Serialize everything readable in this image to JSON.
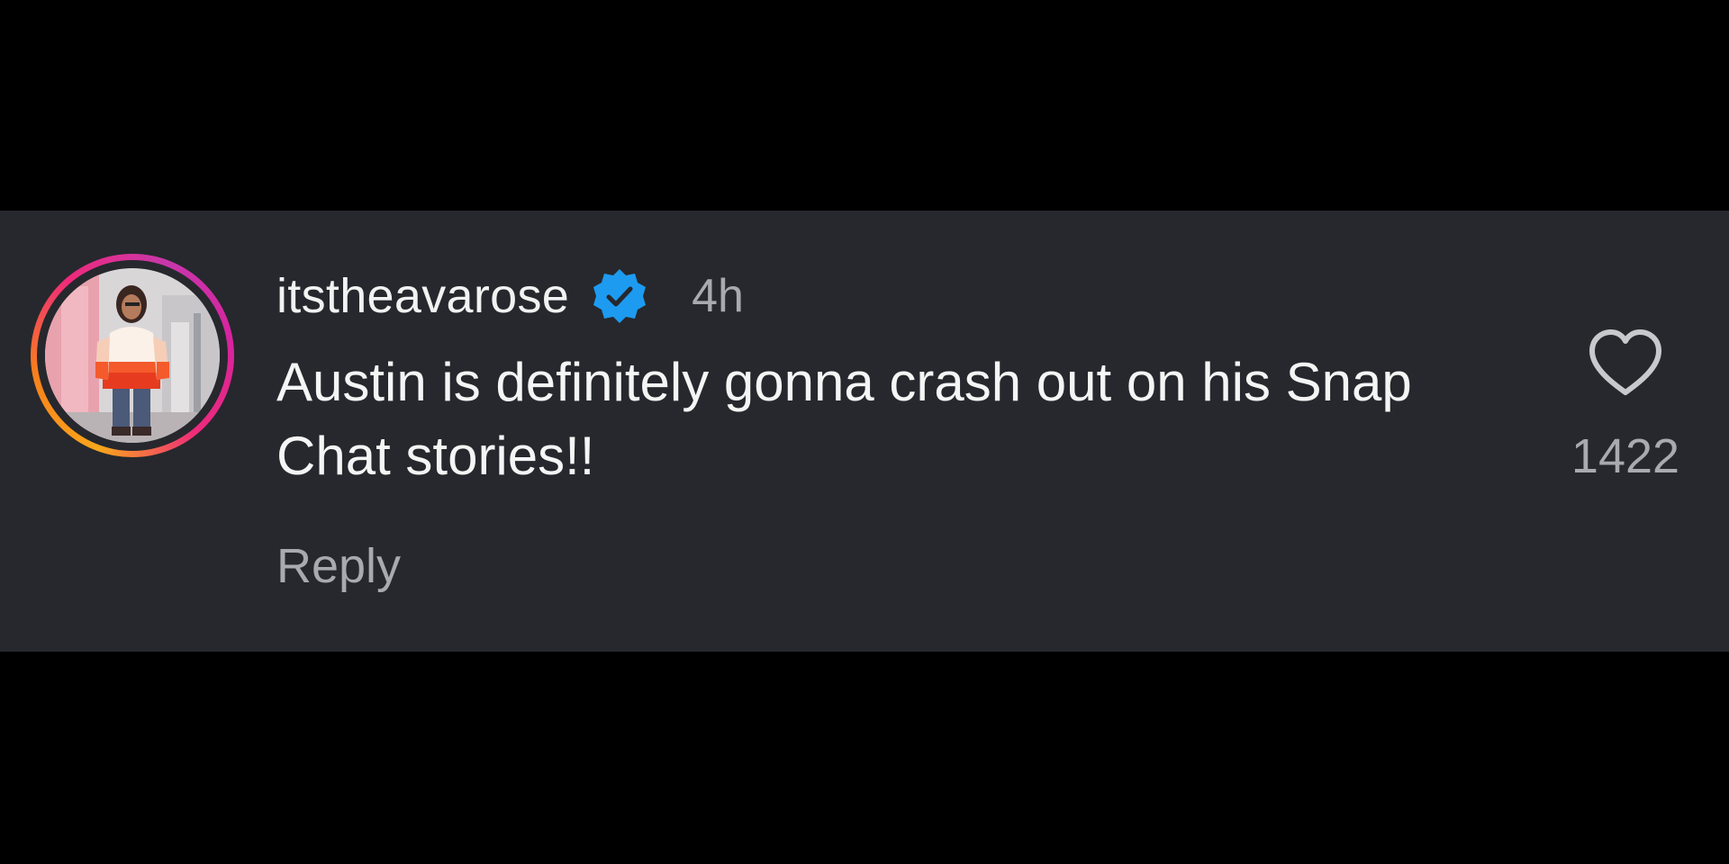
{
  "comment": {
    "username": "itstheavarose",
    "verified": true,
    "timestamp": "4h",
    "text": "Austin is definitely gonna crash out on his Snap Chat stories!!",
    "reply_label": "Reply",
    "like_count": "1422",
    "avatar_icon": "profile-photo",
    "heart_icon": "heart-outline-icon",
    "verified_icon": "verified-badge-icon"
  },
  "colors": {
    "background": "#000000",
    "card": "#26282d",
    "primary_text": "#f5f5f5",
    "secondary_text": "#a8aab0",
    "verified_blue": "#1d9bf0",
    "story_ring_start": "#f9a71b",
    "story_ring_end": "#d6249f"
  }
}
